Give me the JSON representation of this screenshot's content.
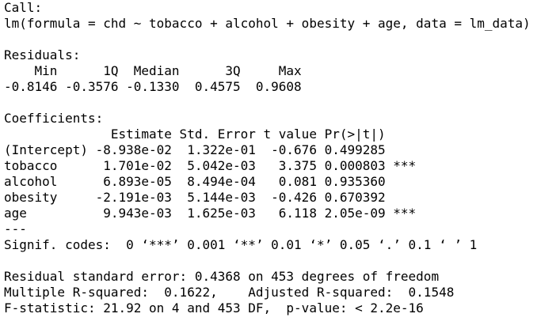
{
  "call": {
    "heading": "Call:",
    "formula": "lm(formula = chd ~ tobacco + alcohol + obesity + age, data = lm_data)"
  },
  "residuals": {
    "heading": "Residuals:",
    "header_line": "    Min      1Q  Median      3Q     Max ",
    "values_line": "-0.8146 -0.3576 -0.1330  0.4575  0.9608 "
  },
  "coefficients": {
    "heading": "Coefficients:",
    "header_line": "              Estimate Std. Error t value Pr(>|t|)    ",
    "rows": [
      "(Intercept) -8.938e-02  1.322e-01  -0.676 0.499285    ",
      "tobacco      1.701e-02  5.042e-03   3.375 0.000803 ***",
      "alcohol      6.893e-05  8.494e-04   0.081 0.935360    ",
      "obesity     -2.191e-03  5.144e-03  -0.426 0.670392    ",
      "age          9.943e-03  1.625e-03   6.118 2.05e-09 ***"
    ],
    "separator": "---",
    "signif_codes": "Signif. codes:  0 ‘***’ 0.001 ‘**’ 0.01 ‘*’ 0.05 ‘.’ 0.1 ‘ ’ 1"
  },
  "summary": {
    "residual_se": "Residual standard error: 0.4368 on 453 degrees of freedom",
    "r_squared": "Multiple R-squared:  0.1622,\tAdjusted R-squared:  0.1548 ",
    "f_statistic": "F-statistic: 21.92 on 4 and 453 DF,  p-value: < 2.2e-16"
  }
}
